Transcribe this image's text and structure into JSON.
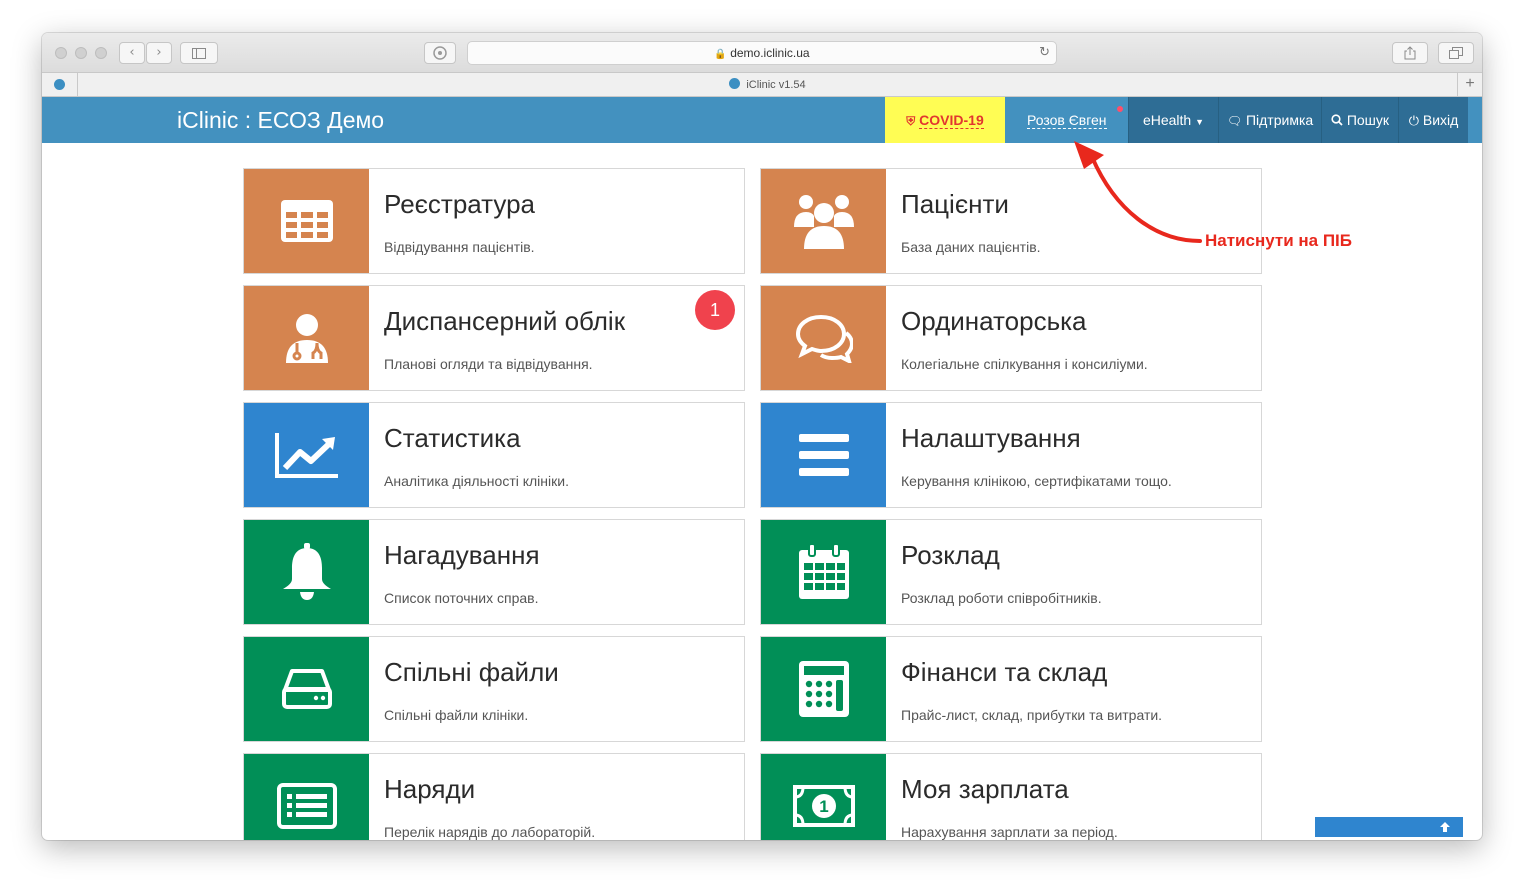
{
  "browser": {
    "address": "demo.iclinic.ua",
    "tab_title": "iClinic v1.54"
  },
  "navbar": {
    "brand": "iClinic : ЕСОЗ Демо",
    "covid_label": "COVID-19",
    "user_name": "Розов Євген",
    "ehealth_label": "eHealth",
    "support_label": "Підтримка",
    "search_label": "Пошук",
    "logout_label": "Вихід"
  },
  "tiles": [
    {
      "title": "Реєстратура",
      "subtitle": "Відвідування пацієнтів.",
      "color": "#d5844f",
      "icon": "grid-table-icon"
    },
    {
      "title": "Пацієнти",
      "subtitle": "База даних пацієнтів.",
      "color": "#d5844f",
      "icon": "users-group-icon"
    },
    {
      "title": "Диспансерний облік",
      "subtitle": "Планові огляди та відвідування.",
      "color": "#d5844f",
      "icon": "doctor-icon",
      "badge": "1"
    },
    {
      "title": "Ординаторська",
      "subtitle": "Колегіальне спілкування і консиліуми.",
      "color": "#d5844f",
      "icon": "chat-bubbles-icon"
    },
    {
      "title": "Статистика",
      "subtitle": "Аналітика діяльності клініки.",
      "color": "#2f85cf",
      "icon": "line-chart-icon"
    },
    {
      "title": "Налаштування",
      "subtitle": "Керування клінікою, сертифікатами тощо.",
      "color": "#2f85cf",
      "icon": "bars-icon"
    },
    {
      "title": "Нагадування",
      "subtitle": "Список поточних справ.",
      "color": "#018f57",
      "icon": "bell-icon"
    },
    {
      "title": "Розклад",
      "subtitle": "Розклад роботи співробітників.",
      "color": "#018f57",
      "icon": "calendar-icon"
    },
    {
      "title": "Спільні файли",
      "subtitle": "Спільні файли клініки.",
      "color": "#018f57",
      "icon": "hard-drive-icon"
    },
    {
      "title": "Фінанси та склад",
      "subtitle": "Прайс-лист, склад, прибутки та витрати.",
      "color": "#018f57",
      "icon": "calculator-icon"
    },
    {
      "title": "Наряди",
      "subtitle": "Перелік нарядів до лабораторій.",
      "color": "#018f57",
      "icon": "list-icon"
    },
    {
      "title": "Моя зарплата",
      "subtitle": "Нарахування зарплати за період.",
      "color": "#018f57",
      "icon": "money-bill-icon"
    }
  ],
  "annotation": {
    "text": "Натиснути на ПІБ",
    "color": "#e8281d"
  }
}
